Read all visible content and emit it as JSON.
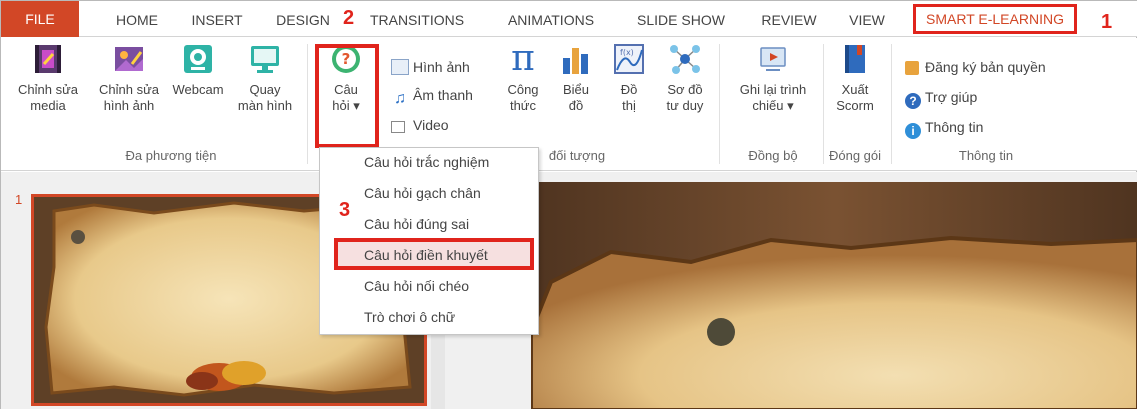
{
  "tabs": {
    "file": "FILE",
    "home": "HOME",
    "insert": "INSERT",
    "design": "DESIGN",
    "transitions": "TRANSITIONS",
    "animations": "ANIMATIONS",
    "slideshow": "SLIDE SHOW",
    "review": "REVIEW",
    "view": "VIEW",
    "smart": "SMART E-LEARNING"
  },
  "steps": {
    "one": "1",
    "two": "2",
    "three": "3"
  },
  "ribbon": {
    "media_group": {
      "label": "Đa phương tiện",
      "edit_media": [
        "Chỉnh sửa",
        "media"
      ],
      "edit_image": [
        "Chỉnh sửa",
        "hình ảnh"
      ],
      "webcam": "Webcam",
      "record": [
        "Quay",
        "màn hình"
      ]
    },
    "question": [
      "Câu",
      "hỏi ▾"
    ],
    "objects_group": {
      "label": "đối tượng",
      "image": "Hình ảnh",
      "audio": "Âm thanh",
      "video": "Video",
      "formula": [
        "Công",
        "thức"
      ],
      "chart": [
        "Biểu",
        "đồ"
      ],
      "graph": [
        "Đồ",
        "thị"
      ],
      "mindmap": [
        "Sơ đồ",
        "tư duy"
      ]
    },
    "sync_group": {
      "label": "Đồng bộ",
      "record_show": [
        "Ghi lại trình",
        "chiếu ▾"
      ]
    },
    "package_group": {
      "label": "Đóng gói",
      "export": [
        "Xuất",
        "Scorm"
      ]
    },
    "info_group": {
      "label": "Thông tin",
      "register": "Đăng ký bản quyền",
      "help": "Trợ giúp",
      "info": "Thông tin"
    }
  },
  "menu": {
    "items": [
      "Câu hỏi trắc nghiệm",
      "Câu hỏi gạch chân",
      "Câu hỏi đúng sai",
      "Câu hỏi điền khuyết",
      "Câu hỏi nối chéo",
      "Trò chơi ô chữ"
    ]
  },
  "slides": {
    "number": "1"
  },
  "colors": {
    "accent": "#d24726",
    "highlight": "#e0241c"
  }
}
